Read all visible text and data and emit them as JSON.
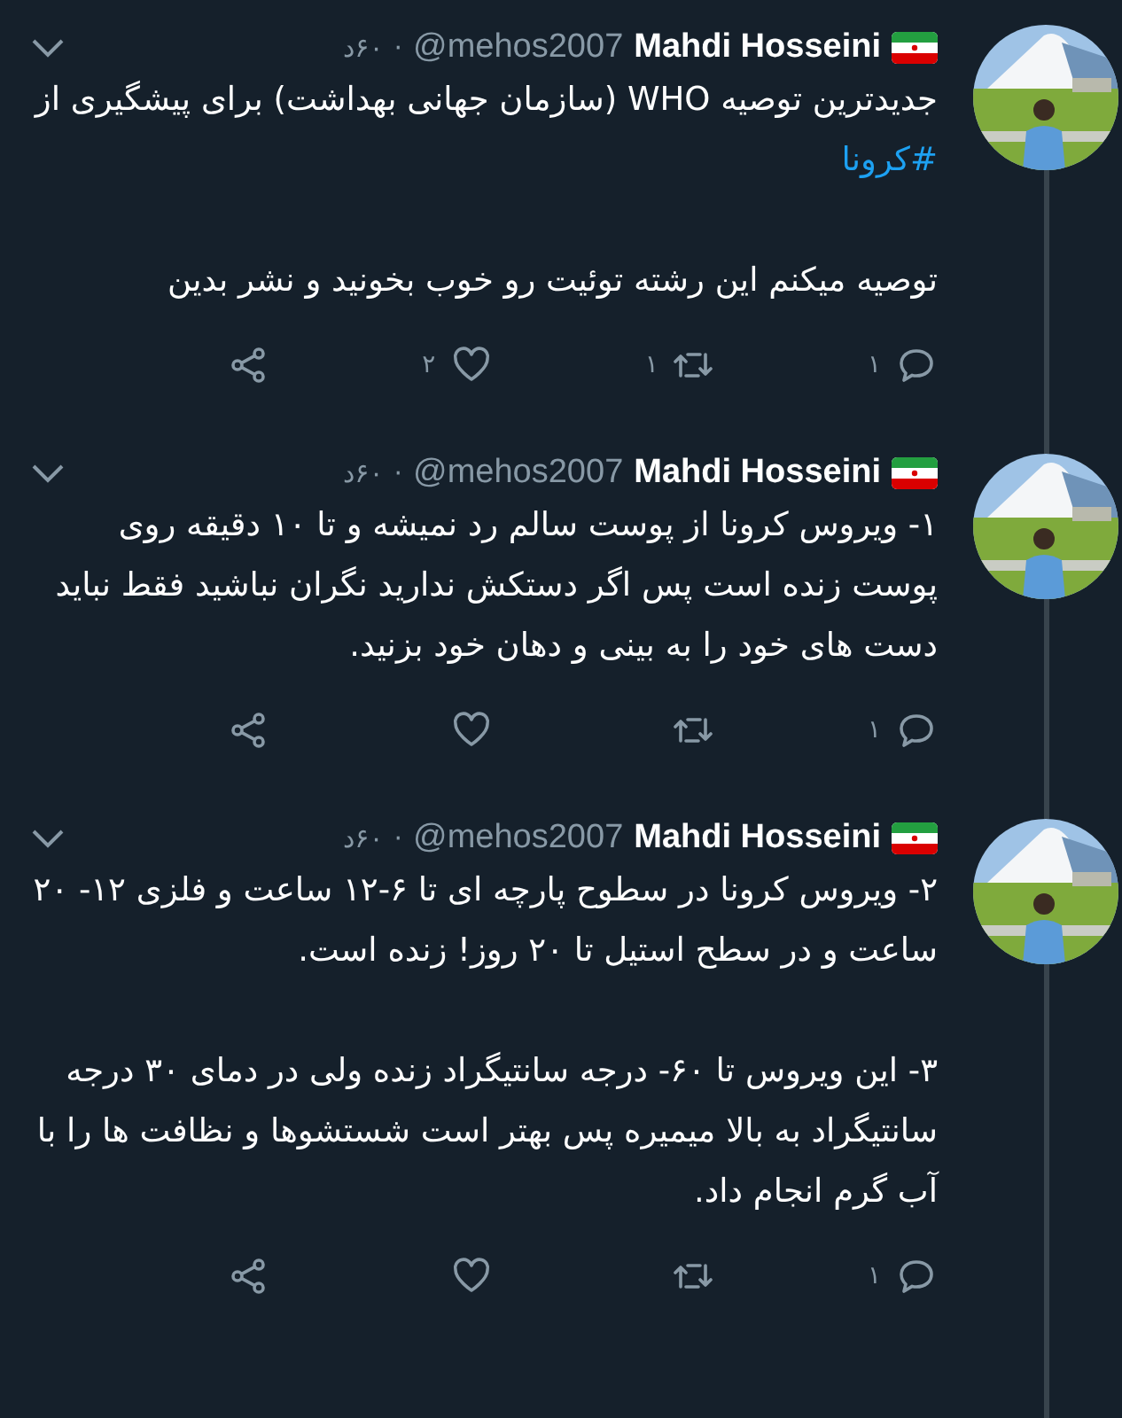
{
  "tweets": [
    {
      "author": {
        "name": "Mahdi Hosseini",
        "handle": "@mehos2007"
      },
      "separator": "·",
      "time": "۶۰د",
      "paragraphs": [
        {
          "text": "جدیدترین توصیه WHO (سازمان جهانی بهداشت) برای پیشگیری از",
          "hashtag": "#کرونا"
        },
        {
          "text": "توصیه میکنم این رشته توئیت رو خوب بخونید و نشر بدین"
        }
      ],
      "actions": {
        "reply": "۱",
        "retweet": "۱",
        "like": "۲"
      }
    },
    {
      "author": {
        "name": "Mahdi Hosseini",
        "handle": "@mehos2007"
      },
      "separator": "·",
      "time": "۶۰د",
      "paragraphs": [
        {
          "text": "۱- ویروس کرونا از پوست سالم رد نمیشه و تا ۱۰ دقیقه روی پوست زنده است پس اگر دستکش ندارید نگران نباشید فقط نباید دست های خود را به بینی و دهان خود بزنید."
        }
      ],
      "actions": {
        "reply": "۱"
      }
    },
    {
      "author": {
        "name": "Mahdi Hosseini",
        "handle": "@mehos2007"
      },
      "separator": "·",
      "time": "۶۰د",
      "paragraphs": [
        {
          "text": "۲- ویروس کرونا در سطوح پارچه ای تا ۶-۱۲ ساعت و فلزی ۱۲- ۲۰ ساعت و در سطح استیل تا ۲۰ روز! زنده است."
        },
        {
          "text": "۳- این ویروس تا ۶۰- درجه سانتیگراد زنده ولی در دمای ۳۰ درجه سانتیگراد به بالا میمیره پس بهتر است شستشوها و نظافت ها را با آب گرم انجام داد."
        }
      ],
      "actions": {
        "reply": "۱"
      }
    }
  ]
}
